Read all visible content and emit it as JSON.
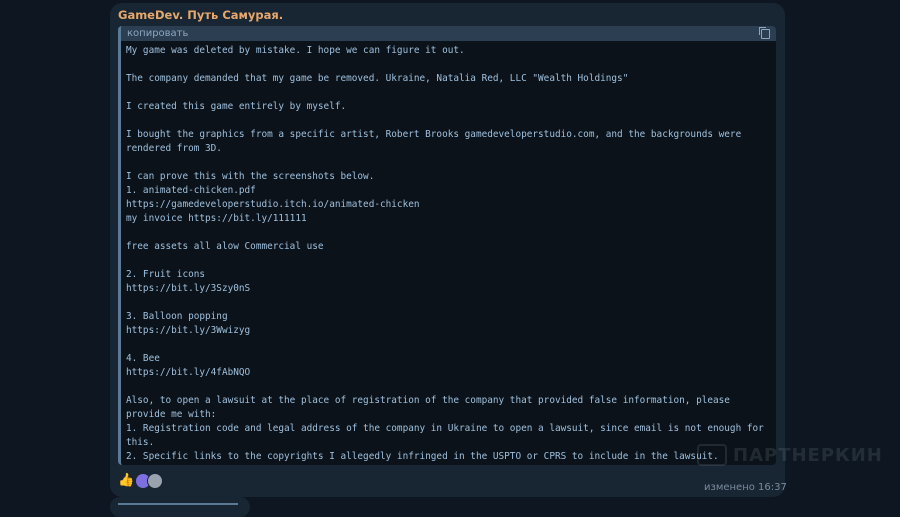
{
  "channel": {
    "name": "GameDev. Путь Самурая."
  },
  "code_block": {
    "copy_label": "копировать",
    "text": "My game was deleted by mistake. I hope we can figure it out.\n\nThe company demanded that my game be removed. Ukraine, Natalia Red, LLC \"Wealth Holdings\"\n\nI created this game entirely by myself.\n\nI bought the graphics from a specific artist, Robert Brooks gamedeveloperstudio.com, and the backgrounds were rendered from 3D.\n\nI can prove this with the screenshots below.\n1. animated-chicken.pdf\nhttps://gamedeveloperstudio.itch.io/animated-chicken\nmy invoice https://bit.ly/111111\n\nfree assets all alow Commercial use\n\n2. Fruit icons\nhttps://bit.ly/3Szy0nS\n\n3. Balloon popping\nhttps://bit.ly/3Wwizyg\n\n4. Bee\nhttps://bit.ly/4fAbNQO\n\nAlso, to open a lawsuit at the place of registration of the company that provided false information, please provide me with:\n1. Registration code and legal address of the company in Ukraine to open a lawsuit, since email is not enough for this.\n2. Specific links to the copyrights I allegedly infringed in the USPTO or CPRS to include in the lawsuit."
  },
  "reactions": {
    "emoji": "👍",
    "icons": [
      "thumbs-up-icon",
      "reactor-avatar-1",
      "reactor-avatar-2"
    ]
  },
  "message": {
    "timestamp": "изменено 16:37"
  },
  "watermark": {
    "text": "ПАРТНЕРКИН"
  },
  "colors": {
    "background": "#0e1621",
    "bubble": "#182533",
    "channel_name": "#e6a86c",
    "code_text": "#9fc0de",
    "code_bg": "#0b1219",
    "code_header": "#2b3e52"
  }
}
